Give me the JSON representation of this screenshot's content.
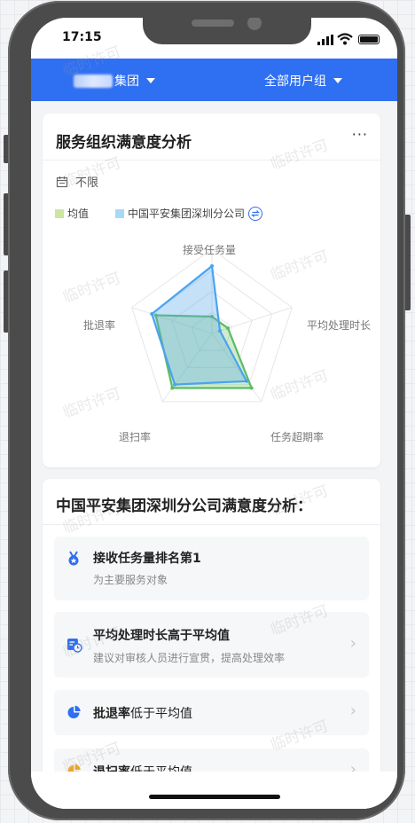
{
  "status_bar": {
    "time": "17:15"
  },
  "top_bar": {
    "left_suffix": "集团",
    "right": "全部用户组"
  },
  "card1": {
    "title": "服务组织满意度分析",
    "more": "···",
    "filter": "不限",
    "legend": [
      {
        "name": "均值",
        "color": "#cbe6a3"
      },
      {
        "name": "中国平安集团深圳分公司",
        "color": "#a6d9f7"
      }
    ],
    "chart_data": {
      "type": "radar",
      "axes": [
        "接受任务量",
        "平均处理时长",
        "任务超期率",
        "退扫率",
        "批退率"
      ],
      "series": [
        {
          "name": "均值",
          "color": "#5dbb63",
          "values": [
            0.2,
            0.2,
            0.8,
            0.8,
            0.7
          ]
        },
        {
          "name": "中国平安集团深圳分公司",
          "color": "#4aa3ef",
          "values": [
            0.8,
            0.1,
            0.7,
            0.75,
            0.75
          ]
        }
      ]
    }
  },
  "card2": {
    "title": "中国平安集团深圳分公司满意度分析：",
    "items": [
      {
        "title": "接收任务量排名第1",
        "title_suffix": "",
        "subtitle": "为主要服务对象",
        "icon": "medal-icon"
      },
      {
        "title": "平均处理时长高于平均值",
        "title_suffix": "",
        "subtitle": "建议对审核人员进行宣贯，提高处理效率",
        "icon": "clock-doc-icon"
      },
      {
        "title": "批退率",
        "title_suffix": "低于平均值",
        "subtitle": "",
        "icon": "pie-chart-icon"
      },
      {
        "title": "退扫率",
        "title_suffix": "低于平均值",
        "subtitle": "",
        "icon": "pie-chart-orange-icon"
      }
    ]
  },
  "watermark": "临时许可"
}
